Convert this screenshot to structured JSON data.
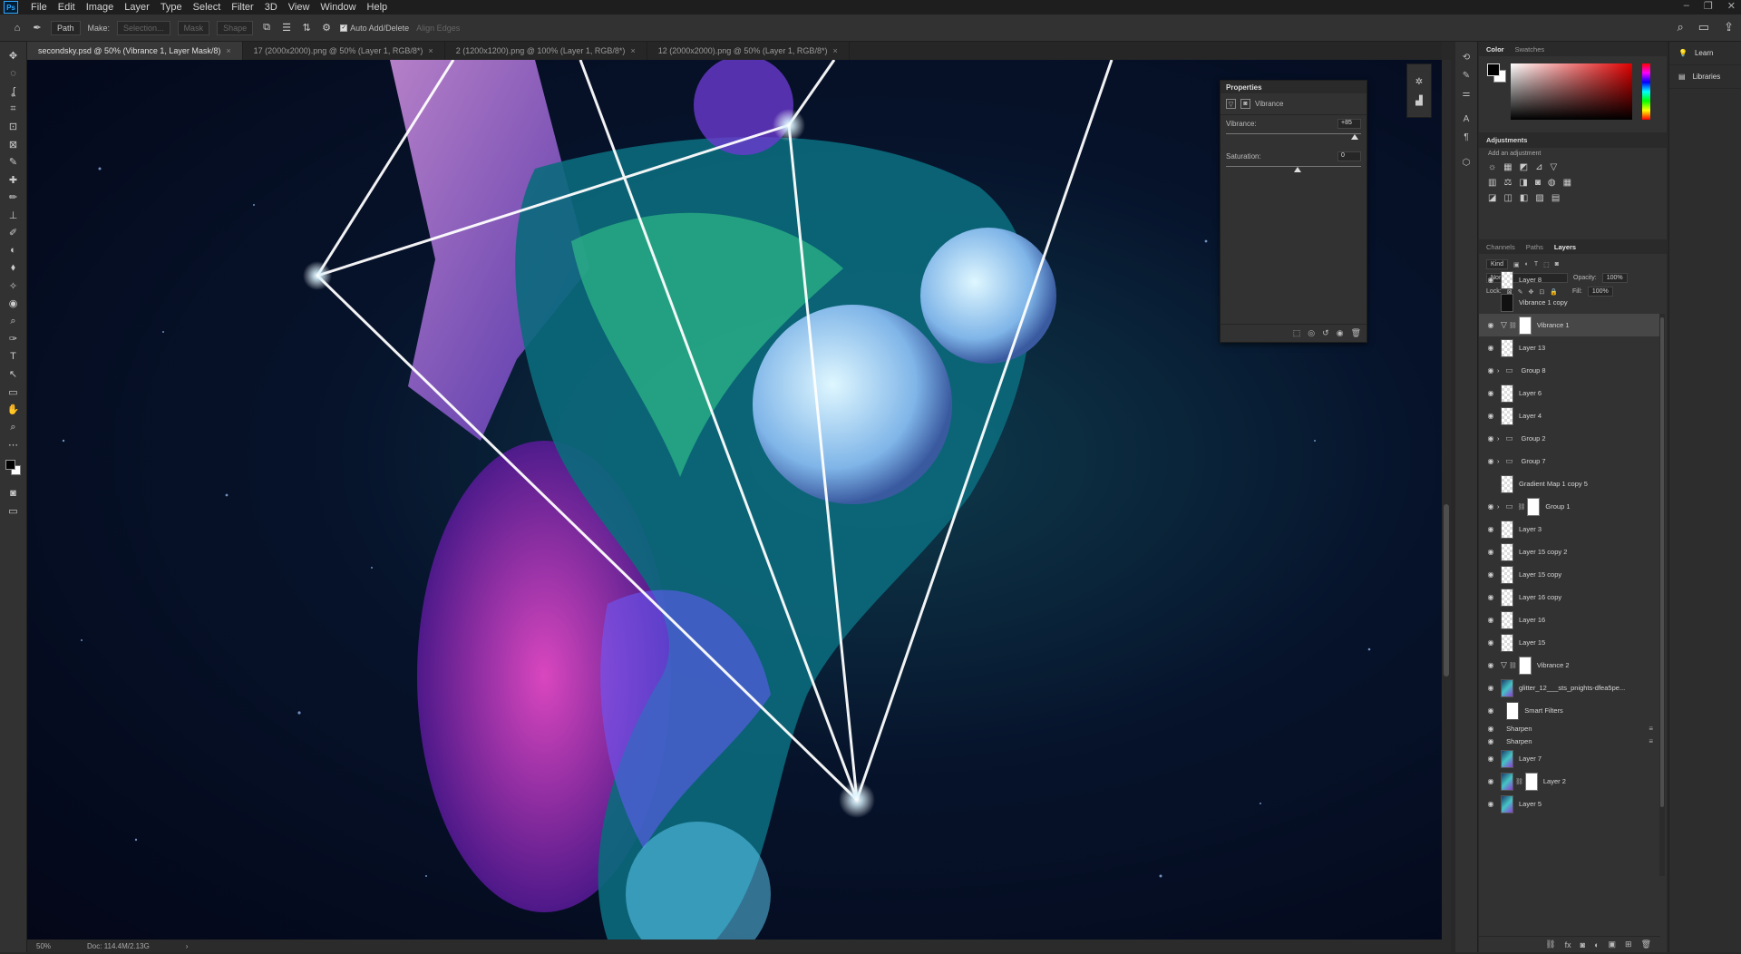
{
  "menu": {
    "logo": "Ps",
    "items": [
      "File",
      "Edit",
      "Image",
      "Layer",
      "Type",
      "Select",
      "Filter",
      "3D",
      "View",
      "Window",
      "Help"
    ],
    "window_controls": [
      "–",
      "❐",
      "✕"
    ]
  },
  "options_bar": {
    "tool_mode": "Path",
    "make_label": "Make:",
    "selection_btn": "Selection...",
    "mask_btn": "Mask",
    "shape_btn": "Shape",
    "auto_add_delete": "Auto Add/Delete",
    "align_edges": "Align Edges",
    "right_icons": [
      "⌕",
      "▭",
      "⇪"
    ]
  },
  "tools": [
    "✥",
    "◌",
    "ʆ",
    "⌗",
    "⊡",
    "⊠",
    "✎",
    "✚",
    "✏",
    "⊥",
    "✐",
    "◐",
    "⬧",
    "✧",
    "◉",
    "⌕",
    "✑",
    "T",
    "↖",
    "▭",
    "✋",
    "⌕",
    "⋯"
  ],
  "tabs": [
    {
      "label": "secondsky.psd @ 50% (Vibrance 1, Layer Mask/8)",
      "active": true
    },
    {
      "label": "17 (2000x2000).png @ 50% (Layer 1, RGB/8*)",
      "active": false
    },
    {
      "label": "2 (1200x1200).png @ 100% (Layer 1, RGB/8*)",
      "active": false
    },
    {
      "label": "12 (2000x2000).png @ 50% (Layer 1, RGB/8*)",
      "active": false
    }
  ],
  "status": {
    "zoom": "50%",
    "doc": "Doc: 114.4M/2.13G",
    "arrow": "›"
  },
  "properties": {
    "title": "Properties",
    "adjustment_name": "Vibrance",
    "vibrance_label": "Vibrance:",
    "vibrance_value": "+85",
    "vibrance_level": 85,
    "saturation_label": "Saturation:",
    "saturation_value": "0",
    "saturation_level": 0,
    "footer_icons": [
      "⬚",
      "◎",
      "↺",
      "◉",
      "🗑"
    ]
  },
  "color_panel": {
    "tabs": [
      "Color",
      "Swatches"
    ],
    "active": "Color",
    "fg": "#000000",
    "bg": "#ffffff",
    "hue_color": "#e00000"
  },
  "adjustments": {
    "title": "Adjustments",
    "subtitle": "Add an adjustment",
    "rows": [
      [
        "☼",
        "▦",
        "◩",
        "⊿",
        "▽"
      ],
      [
        "▥",
        "⚖",
        "◨",
        "◙",
        "◍",
        "▦"
      ],
      [
        "◪",
        "◫",
        "◧",
        "▨",
        "▤"
      ]
    ]
  },
  "layers_panel": {
    "tabs": [
      "Channels",
      "Paths",
      "Layers"
    ],
    "active": "Layers",
    "kind_label": "Kind",
    "blend_mode": "Normal",
    "opacity_label": "Opacity:",
    "opacity": "100%",
    "lock_label": "Lock:",
    "fill_label": "Fill:",
    "fill": "100%",
    "layers": [
      {
        "name": "Layer 8",
        "thumb": "check",
        "visible": true
      },
      {
        "name": "Vibrance 1 copy",
        "thumb": "dark",
        "visible": false
      },
      {
        "name": "Vibrance 1",
        "thumb": "mask",
        "visible": true,
        "adj": true,
        "selected": true
      },
      {
        "name": "Layer 13",
        "thumb": "check",
        "visible": true
      },
      {
        "name": "Group 8",
        "thumb": "folder",
        "visible": true
      },
      {
        "name": "Layer 6",
        "thumb": "check",
        "visible": true
      },
      {
        "name": "Layer 4",
        "thumb": "check",
        "visible": true
      },
      {
        "name": "Group 2",
        "thumb": "folder",
        "visible": true
      },
      {
        "name": "Group 7",
        "thumb": "folder",
        "visible": true
      },
      {
        "name": "Gradient Map 1 copy 5",
        "thumb": "check",
        "visible": false
      },
      {
        "name": "Group 1",
        "thumb": "folder-mask",
        "visible": true
      },
      {
        "name": "Layer 3",
        "thumb": "check",
        "visible": true
      },
      {
        "name": "Layer 15 copy 2",
        "thumb": "check",
        "visible": true
      },
      {
        "name": "Layer 15 copy",
        "thumb": "check",
        "visible": true
      },
      {
        "name": "Layer 16 copy",
        "thumb": "check",
        "visible": true
      },
      {
        "name": "Layer 16",
        "thumb": "check",
        "visible": true
      },
      {
        "name": "Layer 15",
        "thumb": "check",
        "visible": true
      },
      {
        "name": "Vibrance 2",
        "thumb": "mask",
        "visible": true,
        "adj": true
      },
      {
        "name": "glitter_12___sts_pnights-dfea5pe...",
        "thumb": "img",
        "visible": true
      },
      {
        "name": "Smart Filters",
        "thumb": "white",
        "visible": true,
        "indent": true
      },
      {
        "name": "Sharpen",
        "thumb": "none",
        "visible": true,
        "small": true
      },
      {
        "name": "Sharpen",
        "thumb": "none",
        "visible": true,
        "small": true
      },
      {
        "name": "Layer 7",
        "thumb": "img",
        "visible": true
      },
      {
        "name": "Layer 2",
        "thumb": "img-mask",
        "visible": true
      },
      {
        "name": "Layer 5",
        "thumb": "img",
        "visible": true
      }
    ],
    "footer_icons": [
      "⛓",
      "fx",
      "◙",
      "◐",
      "▣",
      "⊞",
      "🗑"
    ]
  },
  "far_right": {
    "items": [
      "Learn",
      "Libraries"
    ],
    "icons": [
      "💡",
      "▤"
    ]
  }
}
